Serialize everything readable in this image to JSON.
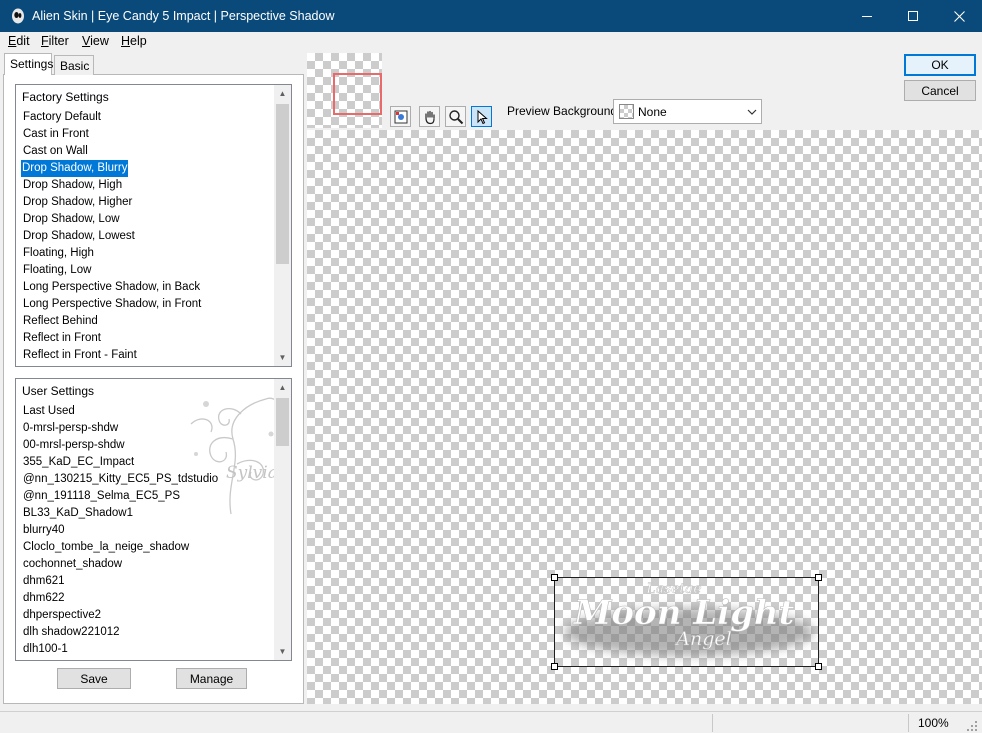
{
  "window": {
    "title": "Alien Skin | Eye Candy 5 Impact | Perspective Shadow"
  },
  "menu": {
    "edit": {
      "u": "E",
      "rest": "dit"
    },
    "filter": {
      "u": "F",
      "rest": "ilter"
    },
    "view": {
      "u": "V",
      "rest": "iew"
    },
    "help": {
      "u": "H",
      "rest": "elp"
    }
  },
  "tabs": {
    "settings": "Settings",
    "basic": "Basic"
  },
  "factory": {
    "header": "Factory Settings",
    "items": [
      "Factory Default",
      "Cast in Front",
      "Cast on Wall",
      "Drop Shadow, Blurry",
      "Drop Shadow, High",
      "Drop Shadow, Higher",
      "Drop Shadow, Low",
      "Drop Shadow, Lowest",
      "Floating, High",
      "Floating, Low",
      "Long Perspective Shadow, in Back",
      "Long Perspective Shadow, in Front",
      "Reflect Behind",
      "Reflect in Front",
      "Reflect in Front - Faint"
    ],
    "selected_index": 3
  },
  "user": {
    "header": "User Settings",
    "items": [
      "Last Used",
      "0-mrsl-persp-shdw",
      "00-mrsl-persp-shdw",
      "355_KaD_EC_Impact",
      "@nn_130215_Kitty_EC5_PS_tdstudio",
      "@nn_191118_Selma_EC5_PS",
      "BL33_KaD_Shadow1",
      "blurry40",
      "Cloclo_tombe_la_neige_shadow",
      "cochonnet_shadow",
      "dhm621",
      "dhm622",
      "dhperspective2",
      "dlh shadow221012",
      "dlh100-1"
    ]
  },
  "buttons": {
    "save": "Save",
    "manage": "Manage",
    "ok": "OK",
    "cancel": "Cancel"
  },
  "preview": {
    "background_label": "Preview Background:",
    "background_value": "None",
    "watermark": "Sylviane"
  },
  "artwork": {
    "top": "Lasetae",
    "main": "Moon Light",
    "sub": "Angel"
  },
  "status": {
    "zoom": "100%"
  },
  "colors": {
    "titlebar": "#0a4a7a",
    "selection": "#0078d7",
    "thumb_frame": "#e86a6a"
  }
}
